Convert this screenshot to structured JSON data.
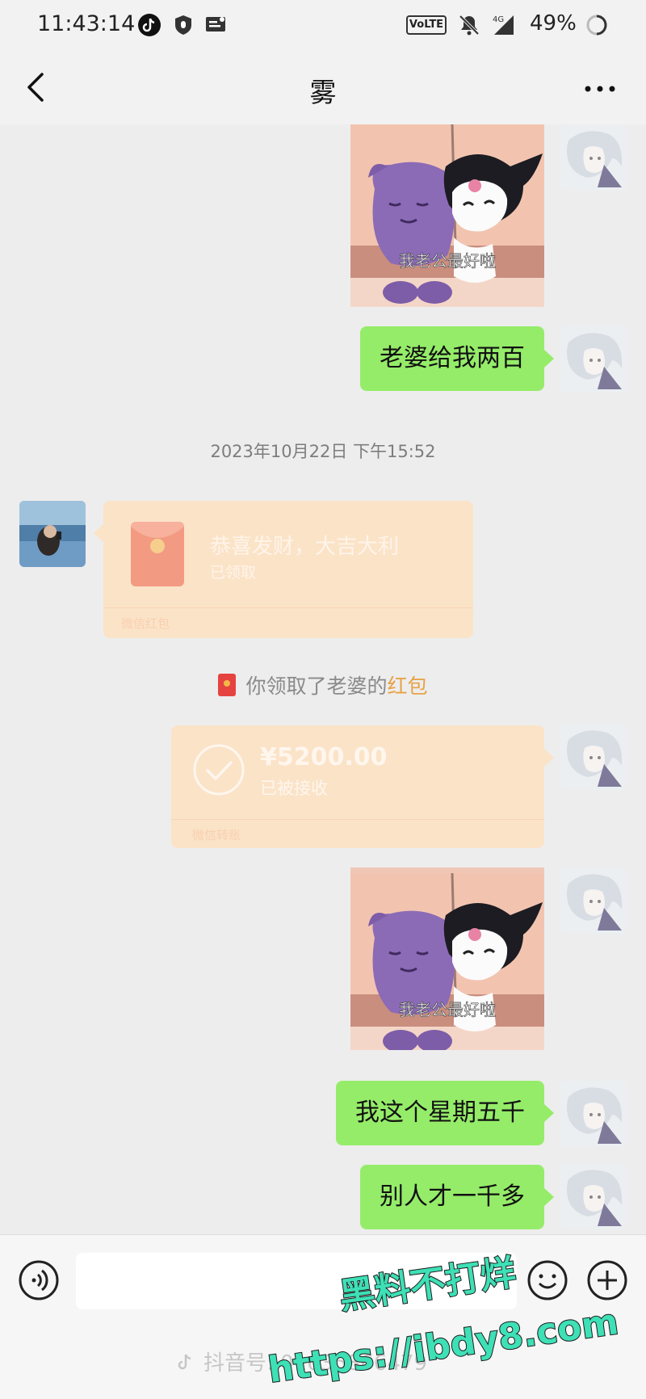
{
  "status_bar": {
    "time": "11:43:14",
    "network_badge": "VoLTE",
    "signal_label": "4G",
    "battery": "49%",
    "icons": [
      "tiktok-icon",
      "shield-icon",
      "message-icon",
      "volte-icon",
      "mute-icon",
      "signal-icon",
      "battery-ring-icon"
    ]
  },
  "header": {
    "title": "雾",
    "back_icon": "chevron-left-icon",
    "more_icon": "more-dots-icon"
  },
  "messages": {
    "sticker_caption_1": "我老公最好啦",
    "bubble_1": "老婆给我两百",
    "timestamp": "2023年10月22日 下午15:52",
    "red_packet": {
      "title": "恭喜发财，大吉大利",
      "status": "已领取",
      "footer": "微信红包"
    },
    "system_note": {
      "prefix": "你领取了老婆的",
      "highlight": "红包"
    },
    "transfer": {
      "amount": "¥5200.00",
      "status": "已被接收",
      "footer": "微信转账"
    },
    "sticker_caption_2": "我老公最好啦",
    "bubble_2": "我这个星期五千",
    "bubble_3": "别人才一千多"
  },
  "input_bar": {
    "voice_icon": "voice-icon",
    "emoji_icon": "emoji-icon",
    "plus_icon": "plus-icon",
    "douyin_watermark": "抖音号: 01635866479"
  },
  "overlay_watermark": {
    "line1": "黑料不打烊",
    "line2": "https://ibdy8.com"
  },
  "colors": {
    "sent_bubble": "#95ec69",
    "background": "#ededed",
    "red_packet_faded": "#fbe3c8",
    "watermark_green": "#3ee0b6"
  }
}
